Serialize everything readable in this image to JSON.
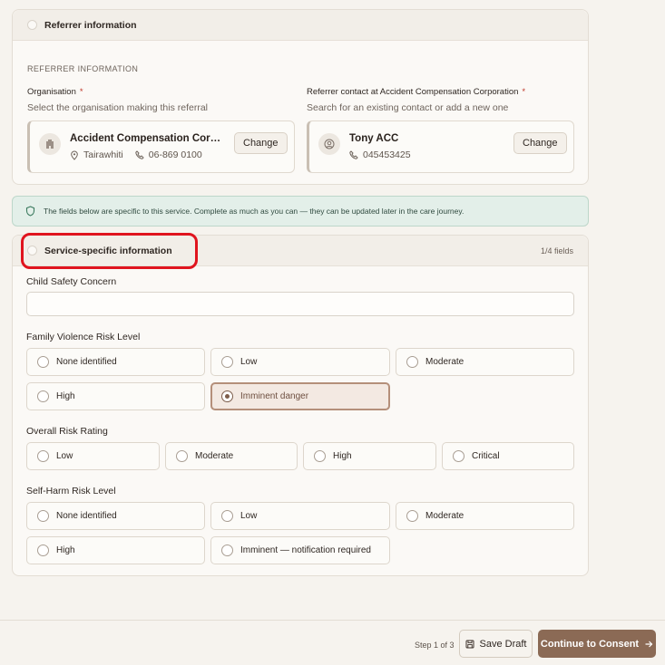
{
  "referrer_card": {
    "header_title": "Referrer information",
    "section_label": "REFERRER INFORMATION",
    "organisation": {
      "label": "Organisation",
      "required_mark": "*",
      "help": "Select the organisation making this referral",
      "name": "Accident Compensation Corporat...",
      "location": "Tairawhiti",
      "phone": "06-869 0100",
      "change_label": "Change"
    },
    "contact": {
      "label": "Referrer contact at Accident Compensation Corporation",
      "required_mark": "*",
      "help": "Search for an existing contact or add a new one",
      "name": "Tony ACC",
      "phone": "045453425",
      "change_label": "Change"
    }
  },
  "info_note": "The fields below are specific to this service. Complete as much as you can — they can be updated later in the care journey.",
  "service_card": {
    "header_title": "Service-specific information",
    "fields_count": "1/4 fields",
    "child_safety": {
      "label": "Child Safety Concern",
      "value": ""
    },
    "family_violence": {
      "label": "Family Violence Risk Level",
      "options": [
        "None identified",
        "Low",
        "Moderate",
        "High",
        "Imminent danger"
      ],
      "selected": "Imminent danger"
    },
    "overall_risk": {
      "label": "Overall Risk Rating",
      "options": [
        "Low",
        "Moderate",
        "High",
        "Critical"
      ],
      "selected": ""
    },
    "self_harm": {
      "label": "Self-Harm Risk Level",
      "options": [
        "None identified",
        "Low",
        "Moderate",
        "High",
        "Imminent — notification required"
      ],
      "selected": ""
    }
  },
  "footer": {
    "step": "Step 1 of 3",
    "save_draft": "Save Draft",
    "continue": "Continue to Consent"
  },
  "colors": {
    "accent": "#8b6a55",
    "selected_border": "#b48f7a",
    "annotation": "#e0141e",
    "note_bg": "#e3efe9"
  }
}
